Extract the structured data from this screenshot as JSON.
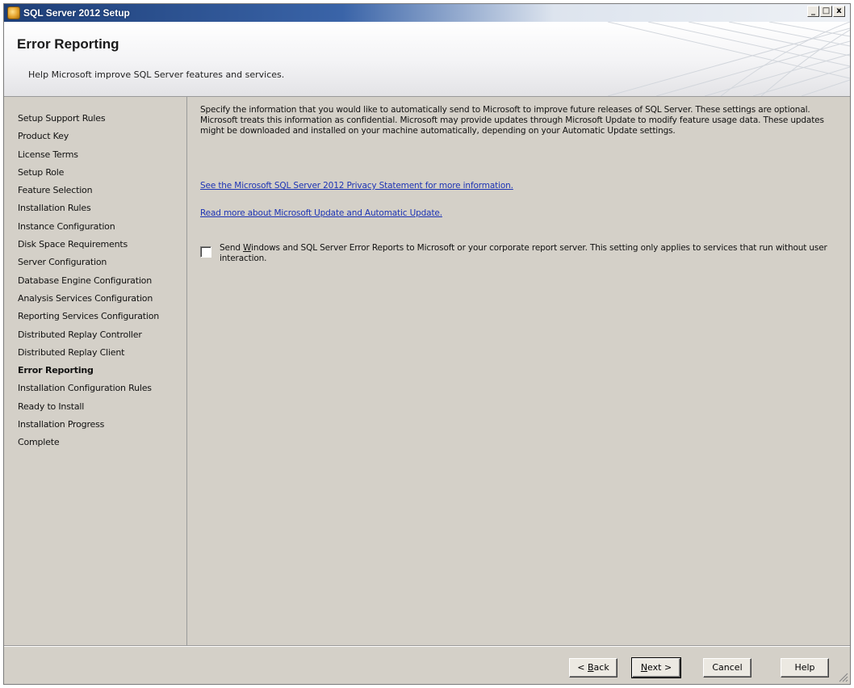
{
  "window": {
    "title": "SQL Server 2012 Setup",
    "minimize_glyph": "_",
    "maximize_glyph": "□",
    "close_glyph": "x"
  },
  "header": {
    "title": "Error Reporting",
    "subtitle": "Help Microsoft improve SQL Server features and services."
  },
  "sidebar": {
    "items": [
      {
        "label": "Setup Support Rules"
      },
      {
        "label": "Product Key"
      },
      {
        "label": "License Terms"
      },
      {
        "label": "Setup Role"
      },
      {
        "label": "Feature Selection"
      },
      {
        "label": "Installation Rules"
      },
      {
        "label": "Instance Configuration"
      },
      {
        "label": "Disk Space Requirements"
      },
      {
        "label": "Server Configuration"
      },
      {
        "label": "Database Engine Configuration"
      },
      {
        "label": "Analysis Services Configuration"
      },
      {
        "label": "Reporting Services Configuration"
      },
      {
        "label": "Distributed Replay Controller"
      },
      {
        "label": "Distributed Replay Client"
      },
      {
        "label": "Error Reporting"
      },
      {
        "label": "Installation Configuration Rules"
      },
      {
        "label": "Ready to Install"
      },
      {
        "label": "Installation Progress"
      },
      {
        "label": "Complete"
      }
    ],
    "active_label": "Error Reporting"
  },
  "main": {
    "description": "Specify the information that you would like to automatically send to Microsoft to improve future releases of SQL Server. These settings are optional. Microsoft treats this information as confidential. Microsoft may provide updates through Microsoft Update to modify feature usage data. These updates might be downloaded and installed on your machine automatically, depending on your Automatic Update settings.",
    "privacy_link": "See the Microsoft SQL Server 2012 Privacy Statement for more information.",
    "update_link": "Read more about Microsoft Update and Automatic Update.",
    "error_report_checkbox": {
      "checked": false,
      "label_prefix": "Send ",
      "label_mnemonic": "W",
      "label_rest": "indows and SQL Server Error Reports to Microsoft or your corporate report server. This setting only applies to services that run without user interaction."
    }
  },
  "footer": {
    "back_prefix": "< ",
    "back_mnemonic": "B",
    "back_rest": "ack",
    "next_mnemonic": "N",
    "next_rest": "ext >",
    "cancel_label": "Cancel",
    "help_label": "Help"
  },
  "colors": {
    "window_bg": "#d4d0c8",
    "link": "#1c33b4",
    "titlebar_start": "#1e3f78"
  }
}
